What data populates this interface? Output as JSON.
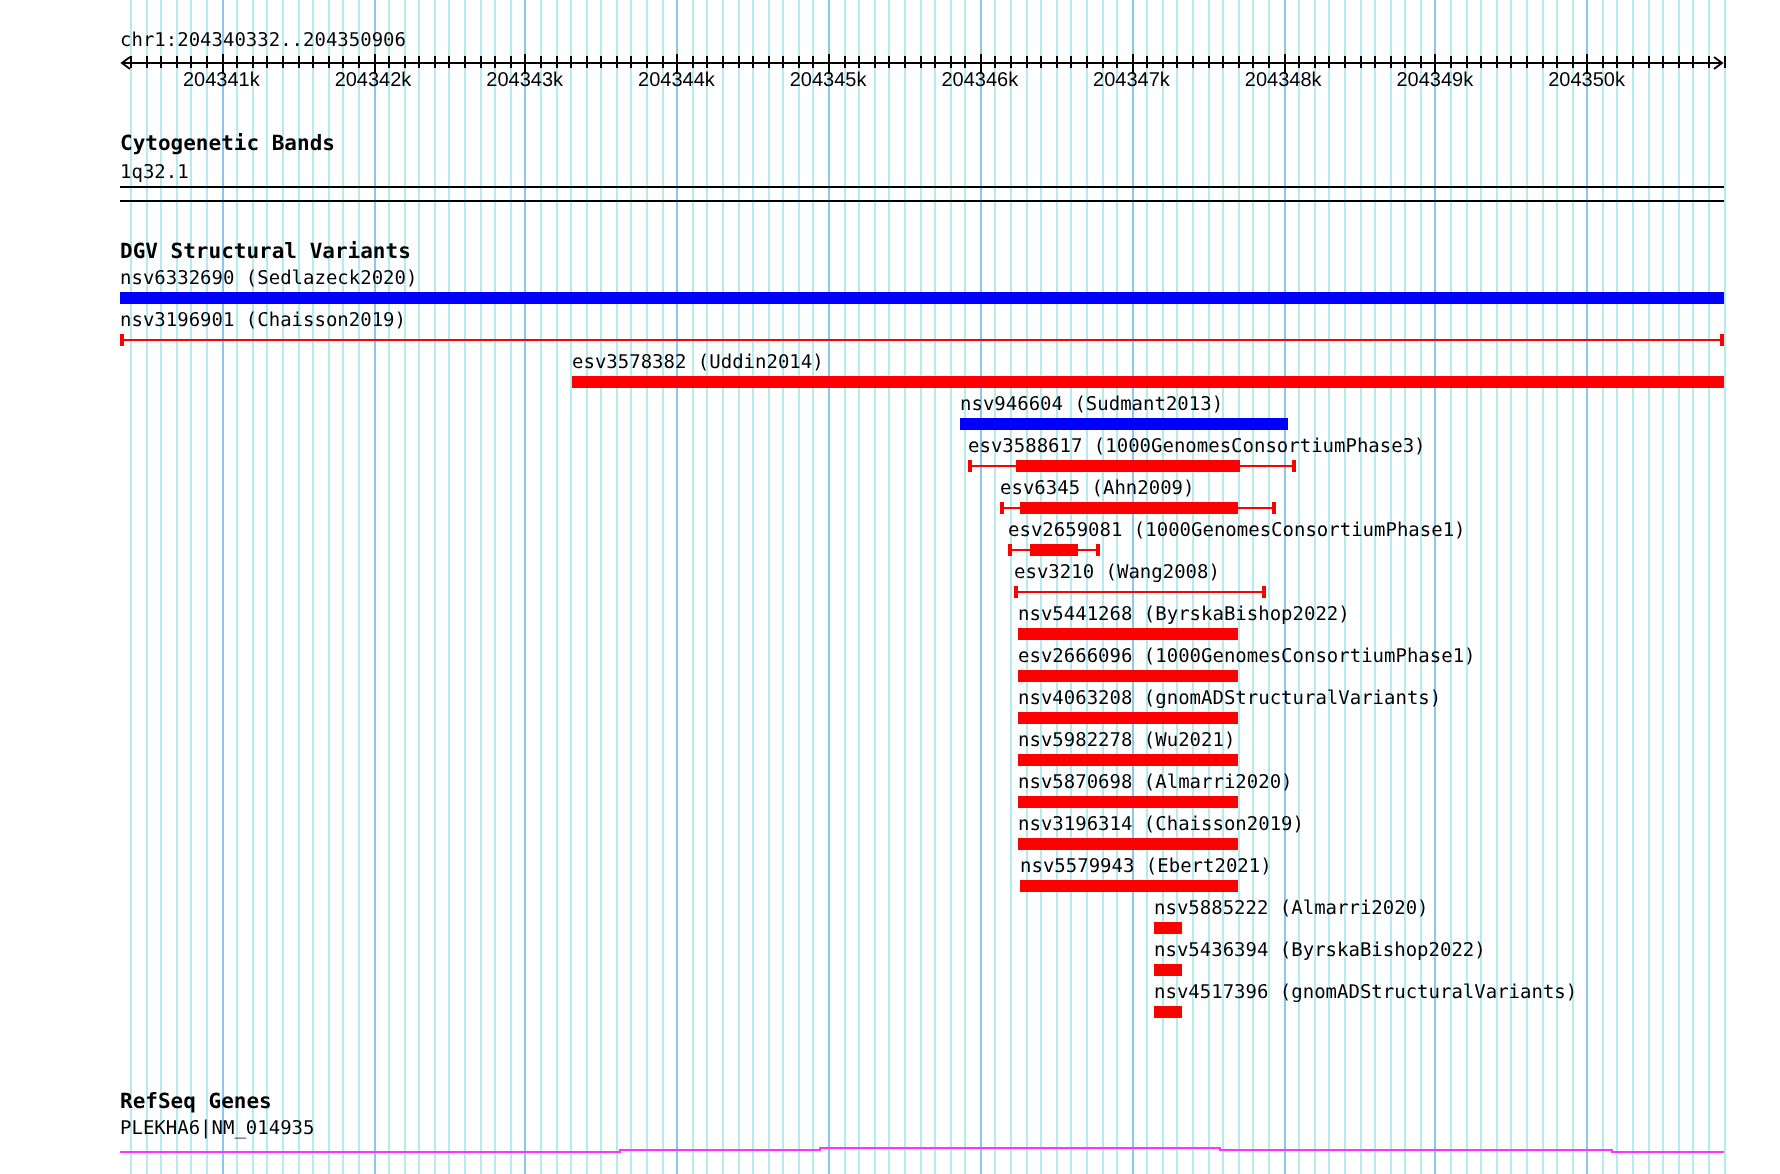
{
  "ruler": {
    "location": "chr1:204340332..204350906",
    "ticks": [
      "204341k",
      "204342k",
      "204343k",
      "204344k",
      "204345k",
      "204346k",
      "204347k",
      "204348k",
      "204349k",
      "204350k"
    ]
  },
  "cytogenetic_bands": {
    "title": "Cytogenetic Bands",
    "band": "1q32.1"
  },
  "dgv_structural_variants": {
    "title": "DGV Structural Variants",
    "features": [
      {
        "label": "nsv6332690 (Sedlazeck2020)",
        "color": "#0000ff",
        "kind": "bar"
      },
      {
        "label": "nsv3196901 (Chaisson2019)",
        "color": "#ff0000",
        "kind": "line"
      },
      {
        "label": "esv3578382 (Uddin2014)",
        "color": "#ff0000",
        "kind": "bar"
      },
      {
        "label": "nsv946604 (Sudmant2013)",
        "color": "#0000ff",
        "kind": "bar"
      },
      {
        "label": "esv3588617 (1000GenomesConsortiumPhase3)",
        "color": "#ff0000",
        "kind": "whisker"
      },
      {
        "label": "esv6345 (Ahn2009)",
        "color": "#ff0000",
        "kind": "whisker"
      },
      {
        "label": "esv2659081 (1000GenomesConsortiumPhase1)",
        "color": "#ff0000",
        "kind": "whisker"
      },
      {
        "label": "esv3210 (Wang2008)",
        "color": "#ff0000",
        "kind": "line"
      },
      {
        "label": "nsv5441268 (ByrskaBishop2022)",
        "color": "#ff0000",
        "kind": "bar"
      },
      {
        "label": "esv2666096 (1000GenomesConsortiumPhase1)",
        "color": "#ff0000",
        "kind": "bar"
      },
      {
        "label": "nsv4063208 (gnomADStructuralVariants)",
        "color": "#ff0000",
        "kind": "bar"
      },
      {
        "label": "nsv5982278 (Wu2021)",
        "color": "#ff0000",
        "kind": "bar"
      },
      {
        "label": "nsv5870698 (Almarri2020)",
        "color": "#ff0000",
        "kind": "bar"
      },
      {
        "label": "nsv3196314 (Chaisson2019)",
        "color": "#ff0000",
        "kind": "bar"
      },
      {
        "label": "nsv5579943 (Ebert2021)",
        "color": "#ff0000",
        "kind": "bar"
      },
      {
        "label": "nsv5885222 (Almarri2020)",
        "color": "#ff0000",
        "kind": "bar"
      },
      {
        "label": "nsv5436394 (ByrskaBishop2022)",
        "color": "#ff0000",
        "kind": "bar"
      },
      {
        "label": "nsv4517396 (gnomADStructuralVariants)",
        "color": "#ff0000",
        "kind": "bar"
      }
    ]
  },
  "refseq_genes": {
    "title": "RefSeq Genes",
    "gene": "PLEKHA6|NM_014935"
  }
}
